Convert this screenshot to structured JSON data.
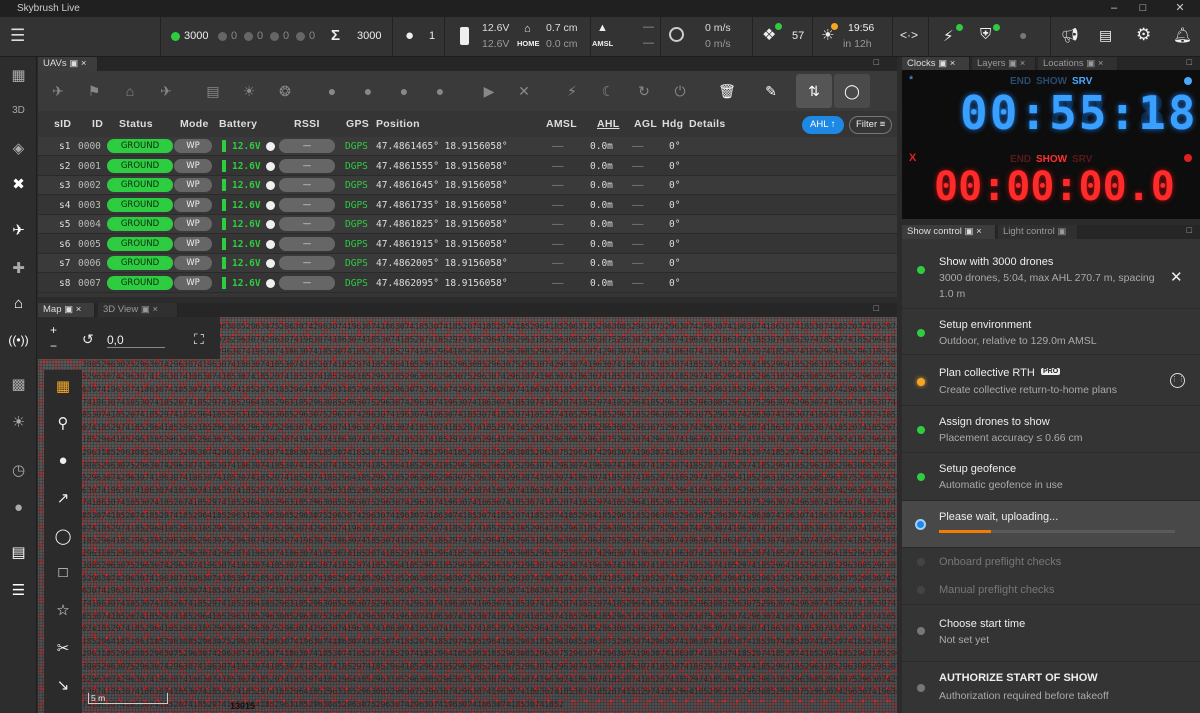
{
  "window": {
    "title": "Skybrush Live",
    "minimize": "–",
    "maximize": "□",
    "close": "✕"
  },
  "topbar": {
    "counts": {
      "green": "3000",
      "c2": "0",
      "c3": "0",
      "c4": "0",
      "c5": "0"
    },
    "sum": "3000",
    "group": "1",
    "battery_top": "12.6V",
    "battery_bottom": "12.6V",
    "home_top": "0.7 cm",
    "home_bottom": "0.0 cm",
    "home_label": "HOME",
    "amsl_label": "AMSL",
    "amsl_top": "—",
    "amsl_bottom": "—",
    "speed_top": "0 m/s",
    "speed_bottom": "0 m/s",
    "satellites": "57",
    "time": "19:56",
    "time_sub": "in 12h",
    "accent": "#2ecc40"
  },
  "uav_panel": {
    "tab_label": "UAVs",
    "headers": [
      "sID",
      "ID",
      "Status",
      "Mode",
      "Battery",
      "RSSI",
      "GPS",
      "Position",
      "AMSL",
      "AHL",
      "AGL",
      "Hdg",
      "Details"
    ],
    "ahl_button": "AHL ↑",
    "filter_button": "Filter",
    "rows": [
      {
        "sid": "s1",
        "id": "0000",
        "status": "GROUND",
        "mode": "WP",
        "battery": "12.6V",
        "rssi": "—",
        "gps": "DGPS",
        "position": "47.4861465° 18.9156058°",
        "amsl": "——",
        "ahl": "0.0m",
        "agl": "——",
        "hdg": "0°"
      },
      {
        "sid": "s2",
        "id": "0001",
        "status": "GROUND",
        "mode": "WP",
        "battery": "12.6V",
        "rssi": "—",
        "gps": "DGPS",
        "position": "47.4861555° 18.9156058°",
        "amsl": "——",
        "ahl": "0.0m",
        "agl": "——",
        "hdg": "0°"
      },
      {
        "sid": "s3",
        "id": "0002",
        "status": "GROUND",
        "mode": "WP",
        "battery": "12.6V",
        "rssi": "—",
        "gps": "DGPS",
        "position": "47.4861645° 18.9156058°",
        "amsl": "——",
        "ahl": "0.0m",
        "agl": "——",
        "hdg": "0°"
      },
      {
        "sid": "s4",
        "id": "0003",
        "status": "GROUND",
        "mode": "WP",
        "battery": "12.6V",
        "rssi": "—",
        "gps": "DGPS",
        "position": "47.4861735° 18.9156058°",
        "amsl": "——",
        "ahl": "0.0m",
        "agl": "——",
        "hdg": "0°"
      },
      {
        "sid": "s5",
        "id": "0004",
        "status": "GROUND",
        "mode": "WP",
        "battery": "12.6V",
        "rssi": "—",
        "gps": "DGPS",
        "position": "47.4861825° 18.9156058°",
        "amsl": "——",
        "ahl": "0.0m",
        "agl": "——",
        "hdg": "0°"
      },
      {
        "sid": "s6",
        "id": "0005",
        "status": "GROUND",
        "mode": "WP",
        "battery": "12.6V",
        "rssi": "—",
        "gps": "DGPS",
        "position": "47.4861915° 18.9156058°",
        "amsl": "——",
        "ahl": "0.0m",
        "agl": "——",
        "hdg": "0°"
      },
      {
        "sid": "s7",
        "id": "0006",
        "status": "GROUND",
        "mode": "WP",
        "battery": "12.6V",
        "rssi": "—",
        "gps": "DGPS",
        "position": "47.4862005° 18.9156058°",
        "amsl": "——",
        "ahl": "0.0m",
        "agl": "——",
        "hdg": "0°"
      },
      {
        "sid": "s8",
        "id": "0007",
        "status": "GROUND",
        "mode": "WP",
        "battery": "12.6V",
        "rssi": "—",
        "gps": "DGPS",
        "position": "47.4862095° 18.9156058°",
        "amsl": "——",
        "ahl": "0.0m",
        "agl": "——",
        "hdg": "0°"
      }
    ]
  },
  "map_panel": {
    "tabs": [
      "Map",
      "3D View"
    ],
    "rotation": "0,0",
    "scale": "5 m",
    "bottom_label": "13015"
  },
  "clocks_panel": {
    "tabs": [
      "Clocks",
      "Layers",
      "Locations"
    ],
    "top_labels": [
      "END",
      "SHOW",
      "SRV"
    ],
    "top_time": "00:55:18",
    "top_ghost": "88:88:88",
    "bottom_labels": [
      "END",
      "SHOW",
      "SRV"
    ],
    "bottom_time": "00:00:00.0",
    "bottom_ghost": "88:88:88.8",
    "x_mark": "X",
    "star_mark": "*"
  },
  "show_panel": {
    "tabs": [
      "Show control",
      "Light control"
    ],
    "steps": [
      {
        "title": "Show with 3000 drones",
        "sub": "3000 drones, 5:04, max AHL 270.7 m, spacing",
        "sub2": "1.0 m",
        "state": "green"
      },
      {
        "title": "Setup environment",
        "sub": "Outdoor, relative to 129.0m AMSL",
        "state": "green"
      },
      {
        "title": "Plan collective RTH",
        "badge": "PRO",
        "sub": "Create collective return-to-home plans",
        "state": "yellow"
      },
      {
        "title": "Assign drones to show",
        "sub": "Placement accuracy ≤ 0.66 cm",
        "state": "green"
      },
      {
        "title": "Setup geofence",
        "sub": "Automatic geofence in use",
        "state": "green"
      },
      {
        "title": "Please wait, uploading...",
        "state": "blue",
        "progress": 0.22
      },
      {
        "title": "Onboard preflight checks",
        "state": "dim"
      },
      {
        "title": "Manual preflight checks",
        "state": "dim"
      },
      {
        "title": "Choose start time",
        "sub": "Not set yet",
        "state": "grey"
      },
      {
        "title": "AUTHORIZE START OF SHOW",
        "sub": "Authorization required before takeoff",
        "state": "grey"
      }
    ]
  }
}
